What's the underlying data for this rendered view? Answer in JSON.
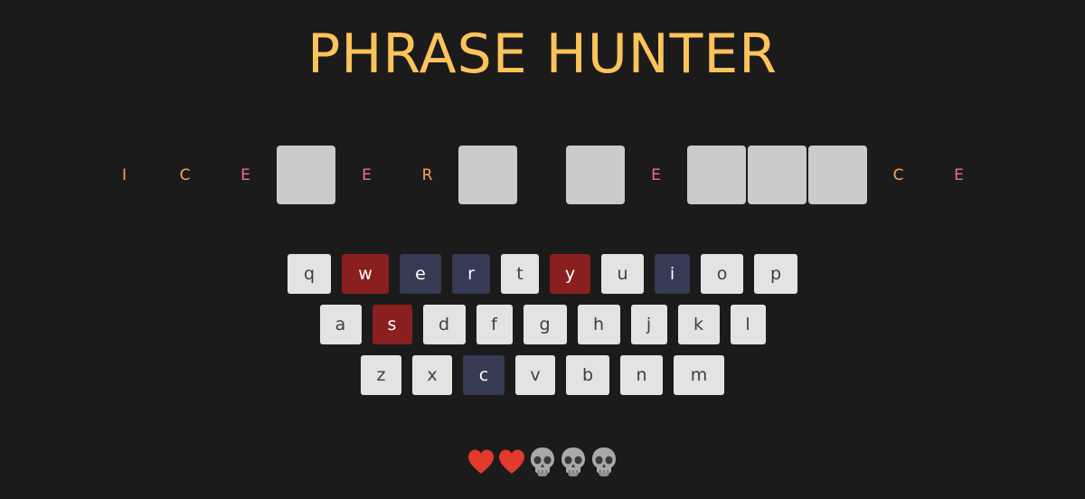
{
  "title": "PHRASE HUNTER",
  "phrase": [
    {
      "char": "I",
      "state": "shown",
      "tone": "orange"
    },
    {
      "char": "C",
      "state": "shown",
      "tone": "orange"
    },
    {
      "char": "E",
      "state": "shown",
      "tone": "pink"
    },
    {
      "char": "",
      "state": "hidden"
    },
    {
      "char": "E",
      "state": "shown",
      "tone": "pink"
    },
    {
      "char": "R",
      "state": "shown",
      "tone": "orange"
    },
    {
      "char": "",
      "state": "hidden"
    },
    {
      "char": " ",
      "state": "space"
    },
    {
      "char": "",
      "state": "hidden"
    },
    {
      "char": "E",
      "state": "shown",
      "tone": "pink"
    },
    {
      "char": "",
      "state": "hidden"
    },
    {
      "char": "",
      "state": "hidden"
    },
    {
      "char": "",
      "state": "hidden"
    },
    {
      "char": "C",
      "state": "shown",
      "tone": "orange"
    },
    {
      "char": "E",
      "state": "shown",
      "tone": "pink"
    }
  ],
  "keyboard": [
    [
      {
        "key": "q",
        "state": "default"
      },
      {
        "key": "w",
        "state": "wrong"
      },
      {
        "key": "e",
        "state": "chosen"
      },
      {
        "key": "r",
        "state": "chosen"
      },
      {
        "key": "t",
        "state": "default"
      },
      {
        "key": "y",
        "state": "wrong"
      },
      {
        "key": "u",
        "state": "default"
      },
      {
        "key": "i",
        "state": "chosen"
      },
      {
        "key": "o",
        "state": "default"
      },
      {
        "key": "p",
        "state": "default"
      }
    ],
    [
      {
        "key": "a",
        "state": "default"
      },
      {
        "key": "s",
        "state": "wrong"
      },
      {
        "key": "d",
        "state": "default"
      },
      {
        "key": "f",
        "state": "default"
      },
      {
        "key": "g",
        "state": "default"
      },
      {
        "key": "h",
        "state": "default"
      },
      {
        "key": "j",
        "state": "default"
      },
      {
        "key": "k",
        "state": "default"
      },
      {
        "key": "l",
        "state": "default"
      }
    ],
    [
      {
        "key": "z",
        "state": "default"
      },
      {
        "key": "x",
        "state": "default"
      },
      {
        "key": "c",
        "state": "chosen"
      },
      {
        "key": "v",
        "state": "default"
      },
      {
        "key": "b",
        "state": "default"
      },
      {
        "key": "n",
        "state": "default"
      },
      {
        "key": "m",
        "state": "default"
      }
    ]
  ],
  "lives": {
    "total": 5,
    "remaining": 2,
    "life_icon": "heart-icon",
    "lost_icon": "skull-icon",
    "heart_color": "#e23a2c"
  },
  "colors": {
    "background": "#1b1b1b",
    "title": "#fdc35b",
    "hidden_tile": "#cbcbcb",
    "letter_orange": "#f6a55b",
    "letter_pink": "#ed6f8b",
    "key_default": "#e3e3e3",
    "key_wrong": "#8a1f1f",
    "key_chosen": "#363a52"
  }
}
